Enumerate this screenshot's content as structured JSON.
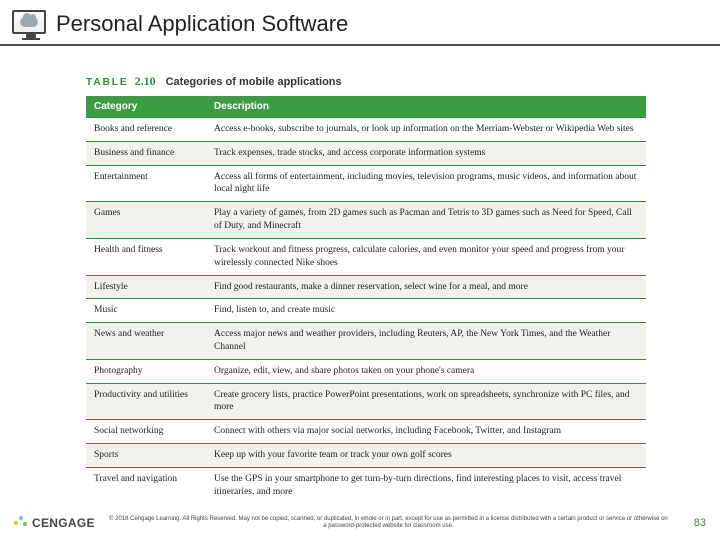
{
  "title": "Personal Application Software",
  "table": {
    "label": "TABLE",
    "number": "2.10",
    "caption": "Categories of mobile applications",
    "headers": [
      "Category",
      "Description"
    ],
    "rows": [
      {
        "cat": "Books and reference",
        "desc": "Access e-books, subscribe to journals, or look up information on the Merriam-Webster or Wikipedia Web sites"
      },
      {
        "cat": "Business and finance",
        "desc": "Track expenses, trade stocks, and access corporate information systems"
      },
      {
        "cat": "Entertainment",
        "desc": "Access all forms of entertainment, including movies, television programs, music videos, and information about local night life"
      },
      {
        "cat": "Games",
        "desc": "Play a variety of games, from 2D games such as Pacman and Tetris to 3D games such as Need for Speed, Call of Duty, and Minecraft"
      },
      {
        "cat": "Health and fitness",
        "desc": "Track workout and fitness progress, calculate calories, and even monitor your speed and progress from your wirelessly connected Nike shoes"
      },
      {
        "cat": "Lifestyle",
        "desc": "Find good restaurants, make a dinner reservation, select wine for a meal, and more"
      },
      {
        "cat": "Music",
        "desc": "Find, listen to, and create music"
      },
      {
        "cat": "News and weather",
        "desc": "Access major news and weather providers, including Reuters, AP, the New York Times, and the Weather Channel"
      },
      {
        "cat": "Photography",
        "desc": "Organize, edit, view, and share photos taken on your phone's camera"
      },
      {
        "cat": "Productivity and utilities",
        "desc": "Create grocery lists, practice PowerPoint presentations, work on spreadsheets, synchronize with PC files, and more"
      },
      {
        "cat": "Social networking",
        "desc": "Connect with others via major social networks, including Facebook, Twitter, and Instagram"
      },
      {
        "cat": "Sports",
        "desc": "Keep up with your favorite team or track your own golf scores"
      },
      {
        "cat": "Travel and navigation",
        "desc": "Use the GPS in your smartphone to get turn-by-turn directions, find interesting places to visit, access travel itineraries, and more"
      }
    ]
  },
  "footer": {
    "brand": "CENGAGE",
    "copyright": "© 2018 Cengage Learning. All Rights Reserved. May not be copied, scanned, or duplicated, in whole or in part, except for use as permitted in a license distributed with a certain product or service or otherwise on a password-protected website for classroom use.",
    "page": "83"
  }
}
